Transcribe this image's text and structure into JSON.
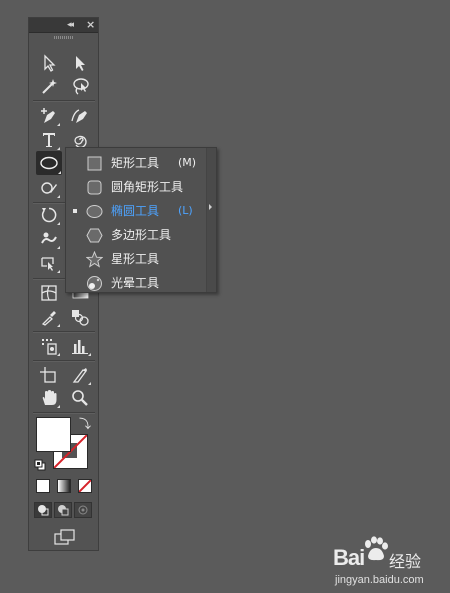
{
  "panel": {
    "collapse_glyph": "◂◂",
    "close_glyph": "×"
  },
  "flyout": {
    "items": [
      {
        "label": "矩形工具",
        "key": "(M)",
        "icon": "rectangle-icon",
        "selected": false
      },
      {
        "label": "圆角矩形工具",
        "key": "",
        "icon": "rounded-rectangle-icon",
        "selected": false
      },
      {
        "label": "椭圆工具",
        "key": "(L)",
        "icon": "ellipse-icon",
        "selected": true
      },
      {
        "label": "多边形工具",
        "key": "",
        "icon": "polygon-icon",
        "selected": false
      },
      {
        "label": "星形工具",
        "key": "",
        "icon": "star-icon",
        "selected": false
      },
      {
        "label": "光晕工具",
        "key": "",
        "icon": "flare-icon",
        "selected": false
      }
    ]
  },
  "colors": {
    "background": "#5b5b5b",
    "panel": "#535353",
    "selected_text": "#4da3ff"
  },
  "watermark": {
    "brand": "Bai",
    "brand_suffix": "经验",
    "url": "jingyan.baidu.com"
  }
}
